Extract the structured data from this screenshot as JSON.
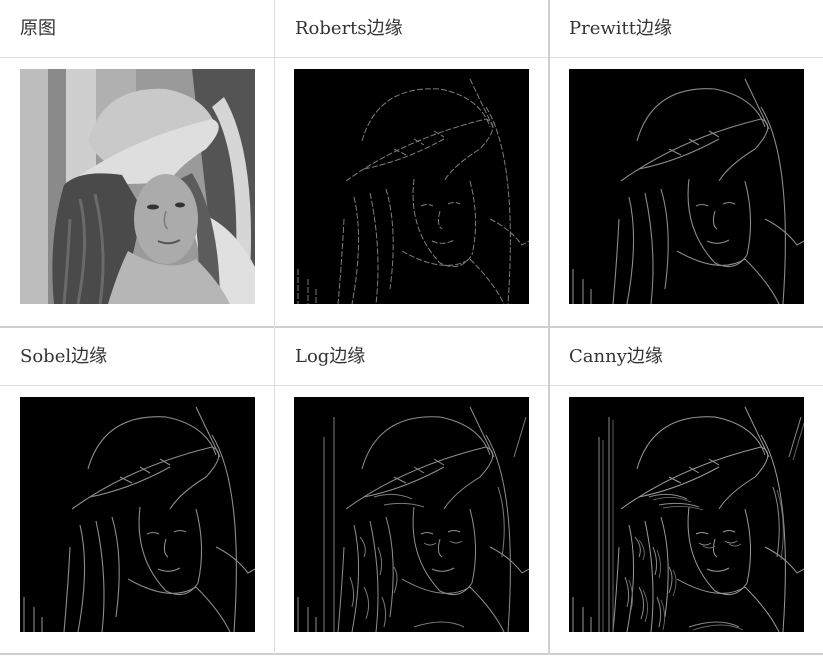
{
  "table": {
    "rows": [
      {
        "cells": [
          {
            "label": "原图"
          },
          {
            "label": "Roberts边缘"
          },
          {
            "label": "Prewitt边缘"
          }
        ]
      },
      {
        "cells": [
          {
            "label": "Sobel边缘"
          },
          {
            "label": "Log边缘"
          },
          {
            "label": "Canny边缘"
          }
        ]
      }
    ]
  },
  "colors": {
    "border": "#dddddd",
    "text": "#333333",
    "edge_background": "#000000",
    "edge_line": "#8c8c8c"
  }
}
